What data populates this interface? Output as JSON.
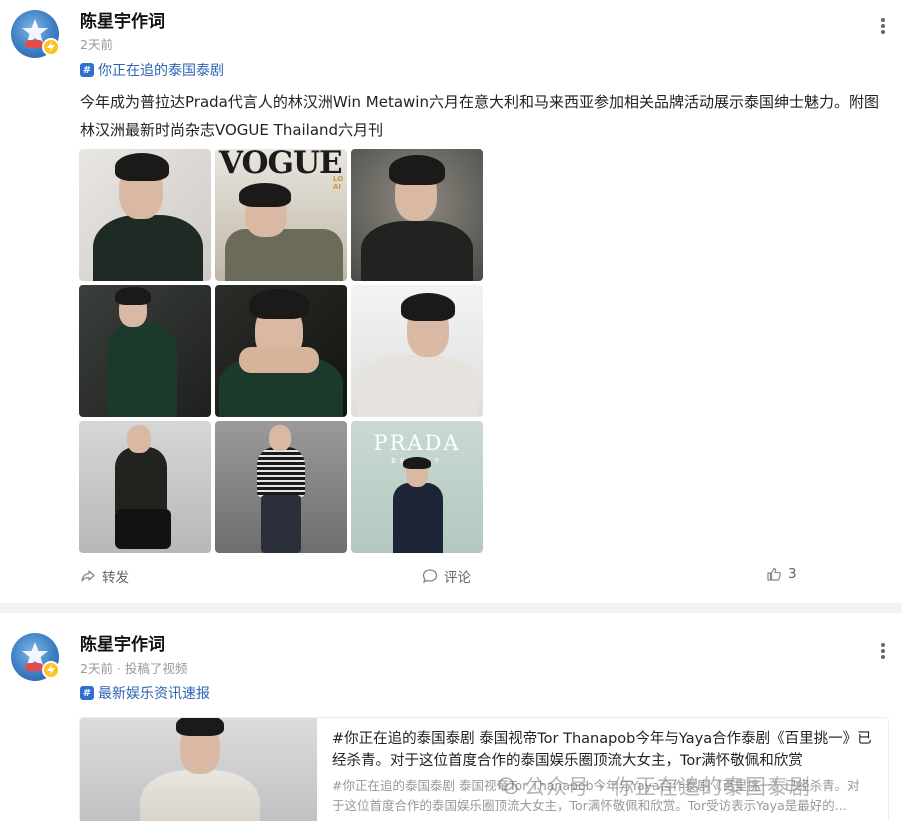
{
  "post1": {
    "author": "陈星宇作词",
    "time": "2天前",
    "topic": "你正在追的泰国泰剧",
    "content": "今年成为普拉达Prada代言人的林汉洲Win Metawin六月在意大利和马来西亚参加相关品牌活动展示泰国绅士魅力。附图林汉洲最新时尚杂志VOGUE Thailand六月刊",
    "photos": [
      {
        "icon": "photo-portrait-dark",
        "text": ""
      },
      {
        "icon": "photo-vogue-cover",
        "text": "VOGUE"
      },
      {
        "icon": "photo-portrait-dark",
        "text": ""
      },
      {
        "icon": "photo-green-shirt",
        "text": ""
      },
      {
        "icon": "photo-hands-rings",
        "text": ""
      },
      {
        "icon": "photo-white-shirt",
        "text": ""
      },
      {
        "icon": "photo-seated",
        "text": ""
      },
      {
        "icon": "photo-striped-shirt",
        "text": ""
      },
      {
        "icon": "photo-prada-beauty",
        "text": "PRADA"
      }
    ],
    "cover_small_text": "LO AI",
    "prada_sub": "BEAUTY",
    "actions": {
      "share": "转发",
      "comment": "评论",
      "like_count": "3"
    }
  },
  "post2": {
    "author": "陈星宇作词",
    "time": "2天前 · 投稿了视频",
    "topic": "最新娱乐资讯速报",
    "card_title": "#你正在追的泰国泰剧 泰国视帝Tor Thanapob今年与Yaya合作泰剧《百里挑一》已经杀青。对于这位首度合作的泰国娱乐圈顶流大女主，Tor满怀敬佩和欣赏",
    "card_desc": "#你正在追的泰国泰剧 泰国视帝Tor Thanapob今年与Yaya合作泰剧《百里挑一》已经杀青。对于这位首度合作的泰国娱乐圈顶流大女主，Tor满怀敬佩和欣赏。Tor受访表示Yaya是最好的...",
    "watermark": "公众号 · 你正在追的泰国泰剧"
  },
  "colors": {
    "topic": "#2f63b3",
    "badge": "#ffc21a",
    "separator": "#f1f2f3"
  }
}
